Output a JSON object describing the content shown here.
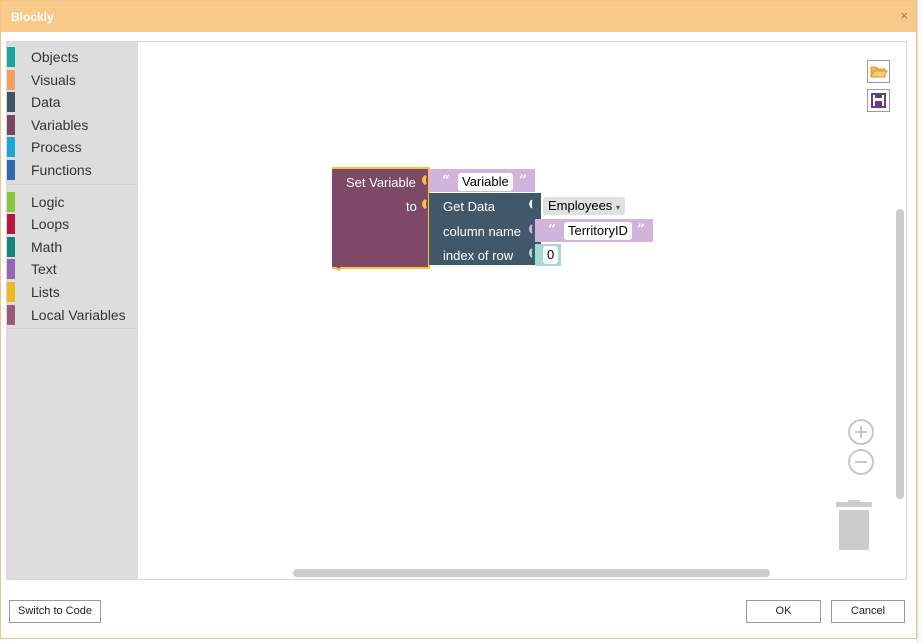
{
  "window": {
    "title": "Blockly",
    "close_glyph": "×"
  },
  "toolbox": {
    "groups": [
      [
        {
          "label": "Objects",
          "color": "#1aa39a"
        },
        {
          "label": "Visuals",
          "color": "#f0a062"
        },
        {
          "label": "Data",
          "color": "#3f5564"
        },
        {
          "label": "Variables",
          "color": "#7a4564"
        },
        {
          "label": "Process",
          "color": "#18a7d6"
        },
        {
          "label": "Functions",
          "color": "#2f67b1"
        }
      ],
      [
        {
          "label": "Logic",
          "color": "#8cc63f"
        },
        {
          "label": "Loops",
          "color": "#b5173c"
        },
        {
          "label": "Math",
          "color": "#12877b"
        },
        {
          "label": "Text",
          "color": "#9466b8"
        },
        {
          "label": "Lists",
          "color": "#f2b822"
        },
        {
          "label": "Local Variables",
          "color": "#9e587a"
        }
      ]
    ]
  },
  "blocks": {
    "set_variable": {
      "label": "Set Variable",
      "to_label": "to",
      "variable_name": "Variable",
      "color": "#7d4967",
      "highlight": "#f5c242"
    },
    "get_data": {
      "label": "Get Data",
      "table": "Employees",
      "column_label": "column name",
      "column_value": "TerritoryID",
      "row_label": "index of row",
      "row_value": "0",
      "color": "#41586a"
    },
    "text_block_color": "#d2b3db",
    "number_block_color": "#a5d8d3",
    "quote_open": "“",
    "quote_close": "”"
  },
  "workspace_icons": {
    "open": "folder-open-icon",
    "save": "save-icon",
    "zoom_in": "zoom-in-icon",
    "zoom_out": "zoom-out-icon",
    "trash": "trash-icon"
  },
  "footer": {
    "switch_label": "Switch to Code",
    "ok_label": "OK",
    "cancel_label": "Cancel"
  }
}
